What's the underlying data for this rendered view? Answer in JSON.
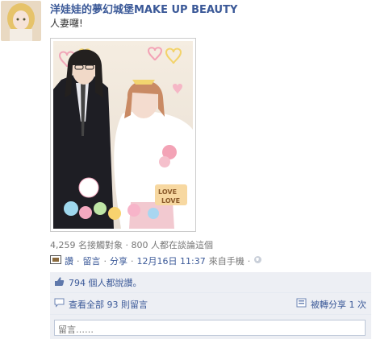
{
  "post": {
    "poster_name": "洋娃娃的夢幻城堡MAKE UP BEAUTY",
    "message": "人妻囉!",
    "photo_stickers": {
      "love_text": "LOVE",
      "love_text_2": "LOVE"
    }
  },
  "meta": {
    "text": "4,259 名接觸對象 · 800 人都在談論這個"
  },
  "actions": {
    "like": "讚",
    "comment": "留言",
    "share": "分享",
    "timestamp": "12月16日 11:37",
    "source": "來自手機",
    "separator": "·"
  },
  "feed": {
    "likes_text": "794 個人都說讚。",
    "view_all_comments": "查看全部 93 則留言",
    "shared_text": "被轉分享 1 次",
    "comment_placeholder": "留言……"
  },
  "colors": {
    "link": "#3b5998",
    "meta": "#777777",
    "feed_bg": "#edeff4"
  }
}
